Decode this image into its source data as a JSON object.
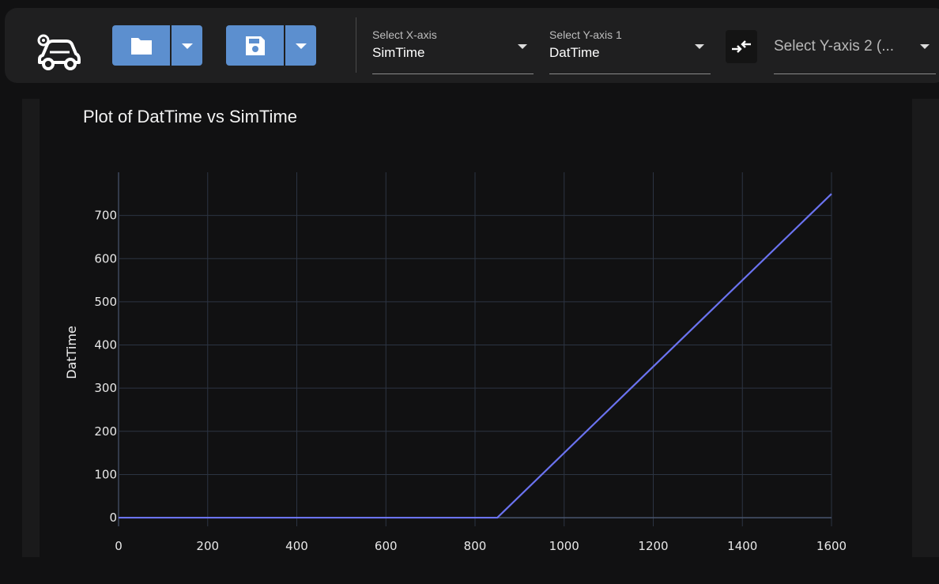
{
  "toolbar": {
    "logo_icon": "car-settings-icon",
    "open_button": {
      "icon": "folder-icon",
      "dropdown_icon": "caret-down-icon"
    },
    "save_button": {
      "icon": "floppy-disk-icon",
      "dropdown_icon": "caret-down-icon"
    },
    "x_axis_select": {
      "label": "Select X-axis",
      "value": "SimTime"
    },
    "y_axis1_select": {
      "label": "Select Y-axis 1",
      "value": "DatTime"
    },
    "swap_button": {
      "icon": "swap-arrows-icon"
    },
    "y_axis2_select": {
      "placeholder": "Select Y-axis 2 (..."
    },
    "accent_color": "#5c8fcf"
  },
  "chart_data": {
    "type": "line",
    "title": "Plot of DatTime vs SimTime",
    "xlabel": "",
    "ylabel": "DatTime",
    "xlim": [
      0,
      1600
    ],
    "ylim": [
      -20,
      800
    ],
    "x_ticks": [
      0,
      200,
      400,
      600,
      800,
      1000,
      1200,
      1400,
      1600
    ],
    "y_ticks": [
      0,
      100,
      200,
      300,
      400,
      500,
      600,
      700
    ],
    "grid": true,
    "series": [
      {
        "color": "#6b73f0",
        "x": [
          0,
          850,
          1600
        ],
        "y": [
          0,
          0,
          750
        ]
      }
    ]
  }
}
